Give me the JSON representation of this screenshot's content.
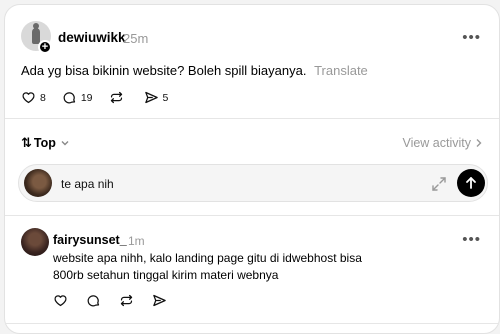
{
  "post": {
    "username": "dewiuwikk",
    "time": "25m",
    "text": "Ada yg bisa bikinin website? Boleh spill biayanya.",
    "translate": "Translate",
    "likes": "8",
    "comments": "19",
    "reposts": "",
    "shares": "5"
  },
  "sort": {
    "label": "Top",
    "view_activity": "View activity"
  },
  "reply": {
    "text": "te apa nih"
  },
  "comment": {
    "username": "fairysunset_",
    "time": "1m",
    "line1": "website apa nihh, kalo landing page gitu di idwebhost bisa",
    "line2": "800rb setahun tinggal kirim materi webnya"
  },
  "icons": {
    "like": "heart-icon",
    "comment": "comment-icon",
    "repost": "repost-icon",
    "share": "share-icon",
    "more": "more-icon",
    "expand": "expand-icon",
    "send": "arrow-up-icon"
  }
}
